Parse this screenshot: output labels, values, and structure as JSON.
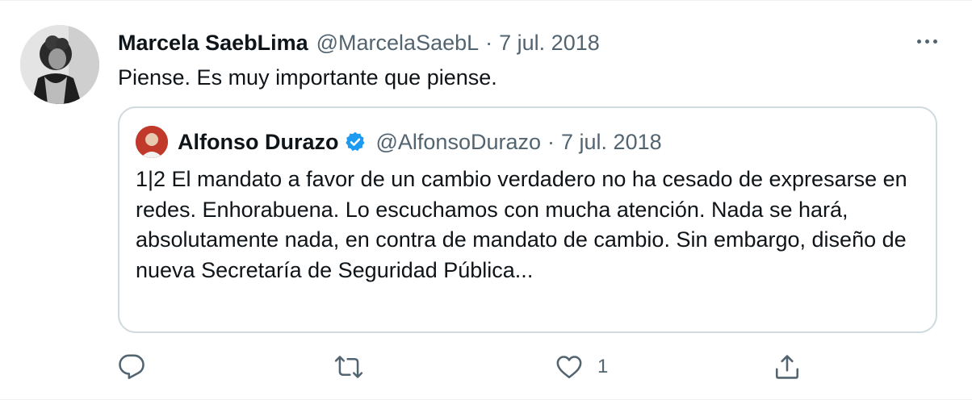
{
  "tweet": {
    "author_name": "Marcela SaebLima",
    "author_handle": "@MarcelaSaebL",
    "separator": "·",
    "date": "7 jul. 2018",
    "text": "Piense. Es muy importante que piense."
  },
  "quoted": {
    "author_name": "Alfonso Durazo",
    "author_handle": "@AlfonsoDurazo",
    "separator": "·",
    "date": "7 jul. 2018",
    "text": "1|2 El mandato a favor de un cambio verdadero no ha cesado de expresarse en redes. Enhorabuena. Lo escuchamos con mucha atención. Nada se hará, absolutamente nada, en contra de mandato de cambio. Sin embargo, diseño de nueva Secretaría de Seguridad Pública..."
  },
  "actions": {
    "like_count": "1",
    "icons": [
      "reply-icon",
      "retweet-icon",
      "like-icon",
      "share-icon"
    ]
  },
  "colors": {
    "text": "#0f1419",
    "secondary": "#536471",
    "border": "#cfd9de",
    "verified": "#1d9bf0"
  }
}
